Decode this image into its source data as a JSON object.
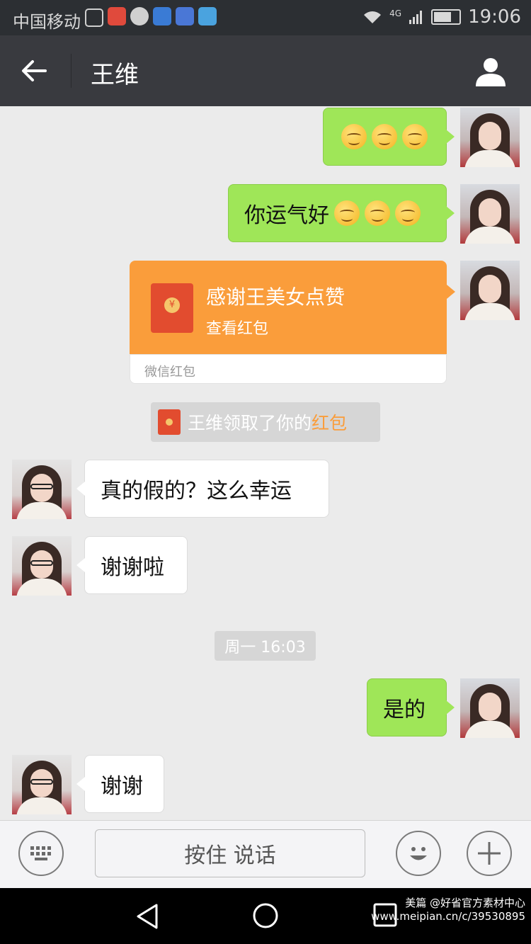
{
  "status_bar": {
    "carrier": "中国移动",
    "network": "4G",
    "time": "19:06"
  },
  "header": {
    "title": "王维"
  },
  "messages": [
    {
      "from": "me",
      "text": "",
      "emojis": 3
    },
    {
      "from": "me",
      "text": "你运气好",
      "emojis": 3
    },
    {
      "from": "me",
      "type": "red_packet",
      "title": "感谢王美女点赞",
      "subtitle": "查看红包",
      "footer": "微信红包"
    },
    {
      "type": "system",
      "text": "王维领取了你的",
      "highlight": "红包"
    },
    {
      "from": "them",
      "text": "真的假的？这么幸运"
    },
    {
      "from": "them",
      "text": "谢谢啦"
    },
    {
      "type": "timestamp",
      "text": "周一 16:03"
    },
    {
      "from": "me",
      "text": "是的"
    },
    {
      "from": "them",
      "text": "谢谢"
    }
  ],
  "input_bar": {
    "hold_to_talk": "按住 说话"
  },
  "watermark": {
    "line1": "美篇 @好省官方素材中心",
    "line2": "www.meipian.cn/c/39530895"
  },
  "colors": {
    "my_bubble": "#9fe658",
    "their_bubble": "#ffffff",
    "red_packet": "#fa9d3b",
    "header": "#393a3f"
  }
}
